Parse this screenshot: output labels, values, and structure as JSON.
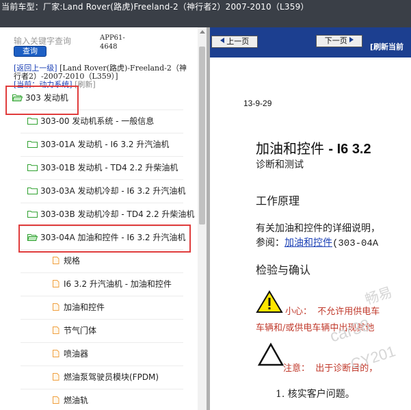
{
  "window": {
    "title": "当前车型：厂家:Land Rover(路虎)Freeland-2（神行者2）2007-2010（L359）"
  },
  "left": {
    "search": {
      "placeholder": "输入关键字查询",
      "button": "查询"
    },
    "app_code": "APP61-4648",
    "breadcrumb": {
      "back_link": "[返回上一级]",
      "path": "[Land Rover(路虎)-Freeland-2（神行者2）-2007-2010（L359）]",
      "current_label": "[当前：动力系统]",
      "refresh": "[刷新]"
    },
    "tree": [
      {
        "label": "303 发动机",
        "icon": "folder-open-icon"
      },
      {
        "label": "303-00 发动机系统 - 一般信息",
        "icon": "folder-icon"
      },
      {
        "label": "303-01A 发动机 - I6 3.2 升汽油机",
        "icon": "folder-icon"
      },
      {
        "label": "303-01B 发动机 - TD4 2.2 升柴油机",
        "icon": "folder-icon"
      },
      {
        "label": "303-03A 发动机冷却 - I6 3.2 升汽油机",
        "icon": "folder-icon"
      },
      {
        "label": "303-03B 发动机冷却 - TD4 2.2 升柴油机",
        "icon": "folder-icon"
      },
      {
        "label": "303-04A 加油和控件 - I6 3.2 升汽油机",
        "icon": "folder-open-icon"
      },
      {
        "label": "规格",
        "icon": "document-icon"
      },
      {
        "label": "I6 3.2 升汽油机 - 加油和控件",
        "icon": "document-icon"
      },
      {
        "label": "加油和控件",
        "icon": "document-icon"
      },
      {
        "label": "节气门体",
        "icon": "document-icon"
      },
      {
        "label": "喷油器",
        "icon": "document-icon"
      },
      {
        "label": "燃油泵驾驶员模块(FPDM)",
        "icon": "document-icon"
      },
      {
        "label": "燃油轨",
        "icon": "document-icon"
      }
    ]
  },
  "right": {
    "nav": {
      "prev": "上一页",
      "next": "下一页",
      "refresh": "[刷新当前"
    },
    "doc": {
      "date": "13-9-29",
      "title_cn": "加油和控件",
      "title_en": "- I6 3.2",
      "subtitle": "诊断和测试",
      "section1": "工作原理",
      "para1": "有关加油和控件的详细说明，",
      "para2_prefix": "参阅：",
      "para2_link": "加油和控件",
      "para2_suffix": "(303-04A",
      "section2": "检验与确认",
      "caution_label": "小心：",
      "caution_text": "不允许用供电车",
      "caution_line2": "车辆和/或供电车辆中出现其他",
      "note_label": "注意：",
      "note_text": "出于诊断目的，",
      "step1": "1. 核实客户问题。"
    },
    "watermarks": [
      "畅易",
      "car38",
      "CY201"
    ]
  },
  "colors": {
    "title_bar": "#3a3f47",
    "nav_bar": "#1c3f90",
    "highlight_box": "#e03c3c",
    "folder_green": "#2fa12f",
    "doc_orange": "#f0a040",
    "link_blue": "#1a3fb5"
  }
}
